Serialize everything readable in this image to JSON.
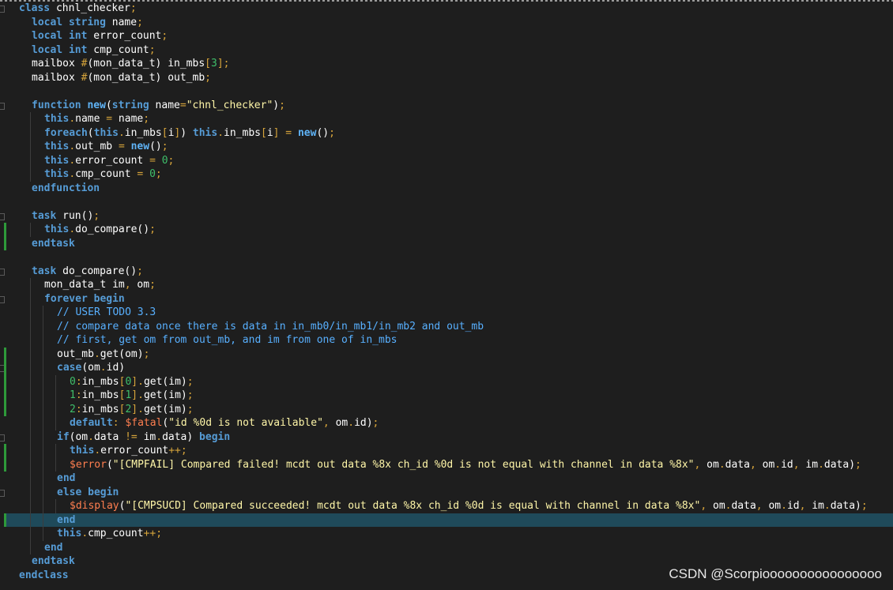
{
  "editor": {
    "language": "SystemVerilog",
    "highlighted_line": 37,
    "lines": [
      {
        "indent": 0,
        "tokens": [
          [
            "kw",
            "class"
          ],
          [
            "id",
            " chnl_checker"
          ],
          [
            "op",
            ";"
          ]
        ]
      },
      {
        "indent": 1,
        "tokens": [
          [
            "kw",
            "local"
          ],
          [
            "id",
            " "
          ],
          [
            "ty",
            "string"
          ],
          [
            "id",
            " name"
          ],
          [
            "op",
            ";"
          ]
        ]
      },
      {
        "indent": 1,
        "tokens": [
          [
            "kw",
            "local"
          ],
          [
            "id",
            " "
          ],
          [
            "ty",
            "int"
          ],
          [
            "id",
            " error_count"
          ],
          [
            "op",
            ";"
          ]
        ]
      },
      {
        "indent": 1,
        "tokens": [
          [
            "kw",
            "local"
          ],
          [
            "id",
            " "
          ],
          [
            "ty",
            "int"
          ],
          [
            "id",
            " cmp_count"
          ],
          [
            "op",
            ";"
          ]
        ]
      },
      {
        "indent": 1,
        "tokens": [
          [
            "id",
            "mailbox "
          ],
          [
            "op",
            "#"
          ],
          [
            "id",
            "(mon_data_t) in_mbs"
          ],
          [
            "op",
            "["
          ],
          [
            "num",
            "3"
          ],
          [
            "op",
            "]"
          ],
          [
            "op",
            ";"
          ]
        ]
      },
      {
        "indent": 1,
        "tokens": [
          [
            "id",
            "mailbox "
          ],
          [
            "op",
            "#"
          ],
          [
            "id",
            "(mon_data_t) out_mb"
          ],
          [
            "op",
            ";"
          ]
        ]
      },
      {
        "indent": 0,
        "tokens": []
      },
      {
        "indent": 1,
        "tokens": [
          [
            "kw",
            "function"
          ],
          [
            "id",
            " "
          ],
          [
            "fn",
            "new"
          ],
          [
            "id",
            "("
          ],
          [
            "ty",
            "string"
          ],
          [
            "id",
            " name"
          ],
          [
            "op",
            "="
          ],
          [
            "str",
            "\"chnl_checker\""
          ],
          [
            "id",
            ")"
          ],
          [
            "op",
            ";"
          ]
        ]
      },
      {
        "indent": 2,
        "tokens": [
          [
            "kw",
            "this"
          ],
          [
            "op",
            "."
          ],
          [
            "id",
            "name "
          ],
          [
            "op",
            "="
          ],
          [
            "id",
            " name"
          ],
          [
            "op",
            ";"
          ]
        ]
      },
      {
        "indent": 2,
        "tokens": [
          [
            "kw",
            "foreach"
          ],
          [
            "id",
            "("
          ],
          [
            "kw",
            "this"
          ],
          [
            "op",
            "."
          ],
          [
            "id",
            "in_mbs"
          ],
          [
            "op",
            "["
          ],
          [
            "id",
            "i"
          ],
          [
            "op",
            "]"
          ],
          [
            "id",
            ") "
          ],
          [
            "kw",
            "this"
          ],
          [
            "op",
            "."
          ],
          [
            "id",
            "in_mbs"
          ],
          [
            "op",
            "["
          ],
          [
            "id",
            "i"
          ],
          [
            "op",
            "]"
          ],
          [
            "id",
            " "
          ],
          [
            "op",
            "="
          ],
          [
            "id",
            " "
          ],
          [
            "fn",
            "new"
          ],
          [
            "id",
            "()"
          ],
          [
            "op",
            ";"
          ]
        ]
      },
      {
        "indent": 2,
        "tokens": [
          [
            "kw",
            "this"
          ],
          [
            "op",
            "."
          ],
          [
            "id",
            "out_mb "
          ],
          [
            "op",
            "="
          ],
          [
            "id",
            " "
          ],
          [
            "fn",
            "new"
          ],
          [
            "id",
            "()"
          ],
          [
            "op",
            ";"
          ]
        ]
      },
      {
        "indent": 2,
        "tokens": [
          [
            "kw",
            "this"
          ],
          [
            "op",
            "."
          ],
          [
            "id",
            "error_count "
          ],
          [
            "op",
            "="
          ],
          [
            "id",
            " "
          ],
          [
            "num",
            "0"
          ],
          [
            "op",
            ";"
          ]
        ]
      },
      {
        "indent": 2,
        "tokens": [
          [
            "kw",
            "this"
          ],
          [
            "op",
            "."
          ],
          [
            "id",
            "cmp_count "
          ],
          [
            "op",
            "="
          ],
          [
            "id",
            " "
          ],
          [
            "num",
            "0"
          ],
          [
            "op",
            ";"
          ]
        ]
      },
      {
        "indent": 1,
        "tokens": [
          [
            "kw",
            "endfunction"
          ]
        ]
      },
      {
        "indent": 0,
        "tokens": []
      },
      {
        "indent": 1,
        "tokens": [
          [
            "kw",
            "task"
          ],
          [
            "id",
            " run()"
          ],
          [
            "op",
            ";"
          ]
        ]
      },
      {
        "indent": 2,
        "tokens": [
          [
            "kw",
            "this"
          ],
          [
            "op",
            "."
          ],
          [
            "id",
            "do_compare()"
          ],
          [
            "op",
            ";"
          ]
        ]
      },
      {
        "indent": 1,
        "tokens": [
          [
            "kw",
            "endtask"
          ]
        ]
      },
      {
        "indent": 0,
        "tokens": []
      },
      {
        "indent": 1,
        "tokens": [
          [
            "kw",
            "task"
          ],
          [
            "id",
            " do_compare()"
          ],
          [
            "op",
            ";"
          ]
        ]
      },
      {
        "indent": 2,
        "tokens": [
          [
            "id",
            "mon_data_t im"
          ],
          [
            "op",
            ","
          ],
          [
            "id",
            " om"
          ],
          [
            "op",
            ";"
          ]
        ]
      },
      {
        "indent": 2,
        "tokens": [
          [
            "kw",
            "forever"
          ],
          [
            "id",
            " "
          ],
          [
            "kw",
            "begin"
          ]
        ]
      },
      {
        "indent": 3,
        "tokens": [
          [
            "cmt",
            "// USER TODO 3.3"
          ]
        ]
      },
      {
        "indent": 3,
        "tokens": [
          [
            "cmt",
            "// compare data once there is data in in_mb0/in_mb1/in_mb2 and out_mb"
          ]
        ]
      },
      {
        "indent": 3,
        "tokens": [
          [
            "cmt",
            "// first, get om from out_mb, and im from one of in_mbs"
          ]
        ]
      },
      {
        "indent": 3,
        "tokens": [
          [
            "id",
            "out_mb"
          ],
          [
            "op",
            "."
          ],
          [
            "id",
            "get(om)"
          ],
          [
            "op",
            ";"
          ]
        ]
      },
      {
        "indent": 3,
        "tokens": [
          [
            "kw",
            "case"
          ],
          [
            "id",
            "(om"
          ],
          [
            "op",
            "."
          ],
          [
            "id",
            "id)"
          ]
        ]
      },
      {
        "indent": 4,
        "tokens": [
          [
            "num",
            "0"
          ],
          [
            "op",
            ":"
          ],
          [
            "id",
            "in_mbs"
          ],
          [
            "op",
            "["
          ],
          [
            "num",
            "0"
          ],
          [
            "op",
            "]"
          ],
          [
            "op",
            "."
          ],
          [
            "id",
            "get(im)"
          ],
          [
            "op",
            ";"
          ]
        ]
      },
      {
        "indent": 4,
        "tokens": [
          [
            "num",
            "1"
          ],
          [
            "op",
            ":"
          ],
          [
            "id",
            "in_mbs"
          ],
          [
            "op",
            "["
          ],
          [
            "num",
            "1"
          ],
          [
            "op",
            "]"
          ],
          [
            "op",
            "."
          ],
          [
            "id",
            "get(im)"
          ],
          [
            "op",
            ";"
          ]
        ]
      },
      {
        "indent": 4,
        "tokens": [
          [
            "num",
            "2"
          ],
          [
            "op",
            ":"
          ],
          [
            "id",
            "in_mbs"
          ],
          [
            "op",
            "["
          ],
          [
            "num",
            "2"
          ],
          [
            "op",
            "]"
          ],
          [
            "op",
            "."
          ],
          [
            "id",
            "get(im)"
          ],
          [
            "op",
            ";"
          ]
        ]
      },
      {
        "indent": 4,
        "tokens": [
          [
            "kw",
            "default"
          ],
          [
            "op",
            ":"
          ],
          [
            "id",
            " "
          ],
          [
            "sys",
            "$fatal"
          ],
          [
            "id",
            "("
          ],
          [
            "str",
            "\"id %0d is not available\""
          ],
          [
            "op",
            ","
          ],
          [
            "id",
            " om"
          ],
          [
            "op",
            "."
          ],
          [
            "id",
            "id)"
          ],
          [
            "op",
            ";"
          ]
        ]
      },
      {
        "indent": 3,
        "tokens": [
          [
            "kw",
            "if"
          ],
          [
            "id",
            "(om"
          ],
          [
            "op",
            "."
          ],
          [
            "id",
            "data "
          ],
          [
            "op",
            "!="
          ],
          [
            "id",
            " im"
          ],
          [
            "op",
            "."
          ],
          [
            "id",
            "data) "
          ],
          [
            "kw",
            "begin"
          ]
        ]
      },
      {
        "indent": 4,
        "tokens": [
          [
            "kw",
            "this"
          ],
          [
            "op",
            "."
          ],
          [
            "id",
            "error_count"
          ],
          [
            "op",
            "++;"
          ]
        ]
      },
      {
        "indent": 4,
        "tokens": [
          [
            "sys",
            "$error"
          ],
          [
            "id",
            "("
          ],
          [
            "str",
            "\"[CMPFAIL] Compared failed! mcdt out data %8x ch_id %0d is not equal with channel in data %8x\""
          ],
          [
            "op",
            ","
          ],
          [
            "id",
            " om"
          ],
          [
            "op",
            "."
          ],
          [
            "id",
            "data"
          ],
          [
            "op",
            ","
          ],
          [
            "id",
            " om"
          ],
          [
            "op",
            "."
          ],
          [
            "id",
            "id"
          ],
          [
            "op",
            ","
          ],
          [
            "id",
            " im"
          ],
          [
            "op",
            "."
          ],
          [
            "id",
            "data)"
          ],
          [
            "op",
            ";"
          ]
        ]
      },
      {
        "indent": 3,
        "tokens": [
          [
            "kw",
            "end"
          ]
        ]
      },
      {
        "indent": 3,
        "tokens": [
          [
            "kw",
            "else"
          ],
          [
            "id",
            " "
          ],
          [
            "kw",
            "begin"
          ]
        ]
      },
      {
        "indent": 4,
        "tokens": [
          [
            "sys",
            "$display"
          ],
          [
            "id",
            "("
          ],
          [
            "str",
            "\"[CMPSUCD] Compared succeeded! mcdt out data %8x ch_id %0d is equal with channel in data %8x\""
          ],
          [
            "op",
            ","
          ],
          [
            "id",
            " om"
          ],
          [
            "op",
            "."
          ],
          [
            "id",
            "data"
          ],
          [
            "op",
            ","
          ],
          [
            "id",
            " om"
          ],
          [
            "op",
            "."
          ],
          [
            "id",
            "id"
          ],
          [
            "op",
            ","
          ],
          [
            "id",
            " im"
          ],
          [
            "op",
            "."
          ],
          [
            "id",
            "data)"
          ],
          [
            "op",
            ";"
          ]
        ]
      },
      {
        "indent": 3,
        "tokens": [
          [
            "kw",
            "end"
          ]
        ]
      },
      {
        "indent": 3,
        "tokens": [
          [
            "kw",
            "this"
          ],
          [
            "op",
            "."
          ],
          [
            "id",
            "cmp_count"
          ],
          [
            "op",
            "++;"
          ]
        ]
      },
      {
        "indent": 2,
        "tokens": [
          [
            "kw",
            "end"
          ]
        ]
      },
      {
        "indent": 1,
        "tokens": [
          [
            "kw",
            "endtask"
          ]
        ]
      },
      {
        "indent": 0,
        "tokens": [
          [
            "kw",
            "endclass"
          ]
        ]
      }
    ]
  },
  "watermark": "CSDN @Scorpioooooooooooooooo"
}
